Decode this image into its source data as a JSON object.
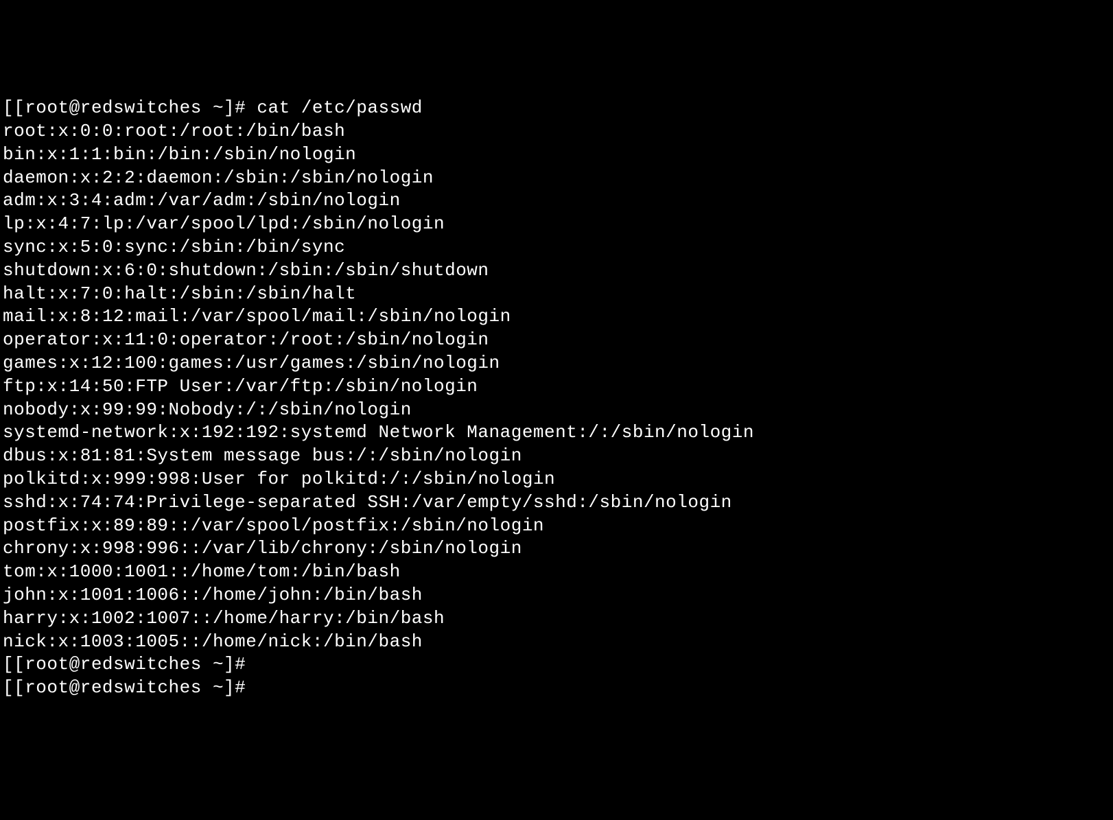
{
  "terminal": {
    "lines": [
      "[[root@redswitches ~]# cat /etc/passwd",
      "root:x:0:0:root:/root:/bin/bash",
      "bin:x:1:1:bin:/bin:/sbin/nologin",
      "daemon:x:2:2:daemon:/sbin:/sbin/nologin",
      "adm:x:3:4:adm:/var/adm:/sbin/nologin",
      "lp:x:4:7:lp:/var/spool/lpd:/sbin/nologin",
      "sync:x:5:0:sync:/sbin:/bin/sync",
      "shutdown:x:6:0:shutdown:/sbin:/sbin/shutdown",
      "halt:x:7:0:halt:/sbin:/sbin/halt",
      "mail:x:8:12:mail:/var/spool/mail:/sbin/nologin",
      "operator:x:11:0:operator:/root:/sbin/nologin",
      "games:x:12:100:games:/usr/games:/sbin/nologin",
      "ftp:x:14:50:FTP User:/var/ftp:/sbin/nologin",
      "nobody:x:99:99:Nobody:/:/sbin/nologin",
      "systemd-network:x:192:192:systemd Network Management:/:/sbin/nologin",
      "dbus:x:81:81:System message bus:/:/sbin/nologin",
      "polkitd:x:999:998:User for polkitd:/:/sbin/nologin",
      "sshd:x:74:74:Privilege-separated SSH:/var/empty/sshd:/sbin/nologin",
      "postfix:x:89:89::/var/spool/postfix:/sbin/nologin",
      "chrony:x:998:996::/var/lib/chrony:/sbin/nologin",
      "tom:x:1000:1001::/home/tom:/bin/bash",
      "john:x:1001:1006::/home/john:/bin/bash",
      "harry:x:1002:1007::/home/harry:/bin/bash",
      "nick:x:1003:1005::/home/nick:/bin/bash",
      "[[root@redswitches ~]#",
      "[[root@redswitches ~]#"
    ]
  }
}
